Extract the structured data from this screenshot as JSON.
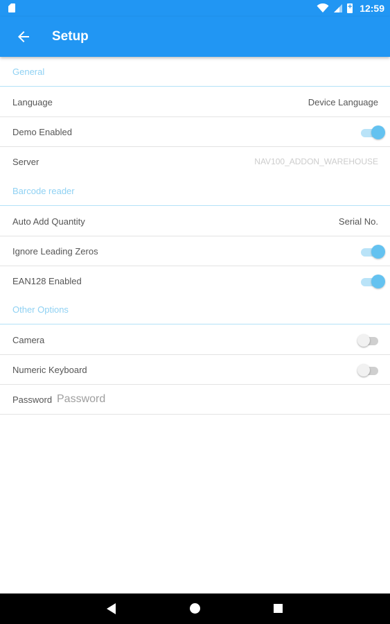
{
  "status_bar": {
    "time": "12:59",
    "icons": [
      "sd-card-icon",
      "wifi-icon",
      "signal-icon",
      "battery-icon"
    ]
  },
  "app_bar": {
    "title": "Setup",
    "back_icon": "arrow-back-icon"
  },
  "sections": {
    "general": {
      "header": "General",
      "language": {
        "label": "Language",
        "value": "Device Language"
      },
      "demo_enabled": {
        "label": "Demo Enabled",
        "on": true
      },
      "server": {
        "label": "Server",
        "value": "NAV100_ADDON_WAREHOUSE"
      }
    },
    "barcode_reader": {
      "header": "Barcode reader",
      "auto_add_quantity": {
        "label": "Auto Add Quantity",
        "value": "Serial No."
      },
      "ignore_leading_zeros": {
        "label": "Ignore Leading Zeros",
        "on": true
      },
      "ean128_enabled": {
        "label": "EAN128 Enabled",
        "on": true
      }
    },
    "other_options": {
      "header": "Other Options",
      "camera": {
        "label": "Camera",
        "on": false
      },
      "numeric_keyboard": {
        "label": "Numeric Keyboard",
        "on": false
      },
      "password": {
        "label": "Password",
        "placeholder": "Password"
      }
    }
  },
  "nav_bar": {
    "icons": [
      "nav-back-icon",
      "nav-home-icon",
      "nav-recents-icon"
    ]
  },
  "colors": {
    "primary": "#2196f3",
    "accent": "#64c2f0",
    "section_header": "#8fd1f3"
  }
}
